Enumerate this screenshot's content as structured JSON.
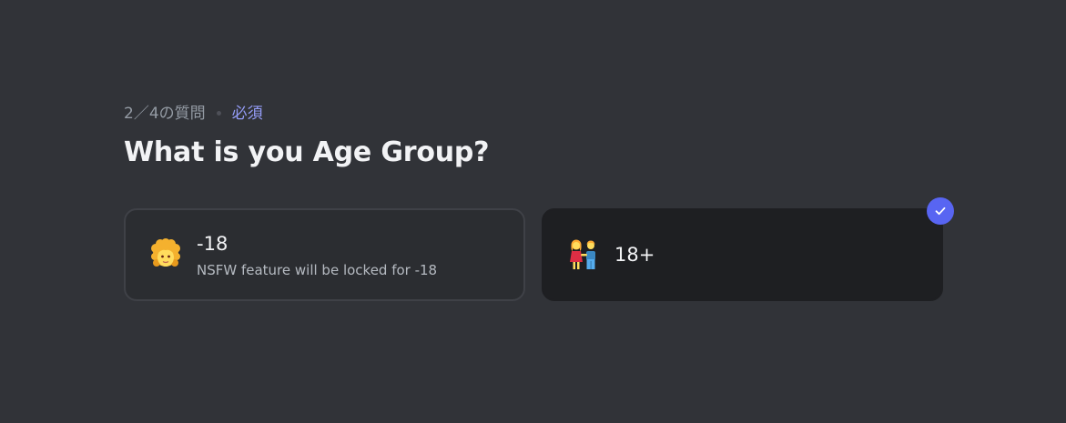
{
  "question": {
    "progress": "2／4の質問",
    "required": "必須",
    "title": "What is you Age Group?"
  },
  "options": [
    {
      "label": "-18",
      "description": "NSFW feature will be locked for -18",
      "icon": "child-emoji-icon",
      "selected": false
    },
    {
      "label": "18+",
      "icon": "couple-emoji-icon",
      "selected": true
    }
  ],
  "colors": {
    "background": "#313338",
    "accent": "#5865f2",
    "required_text": "#949cf7",
    "selected_card": "#1e1f22",
    "unselected_card": "#2b2d31"
  }
}
